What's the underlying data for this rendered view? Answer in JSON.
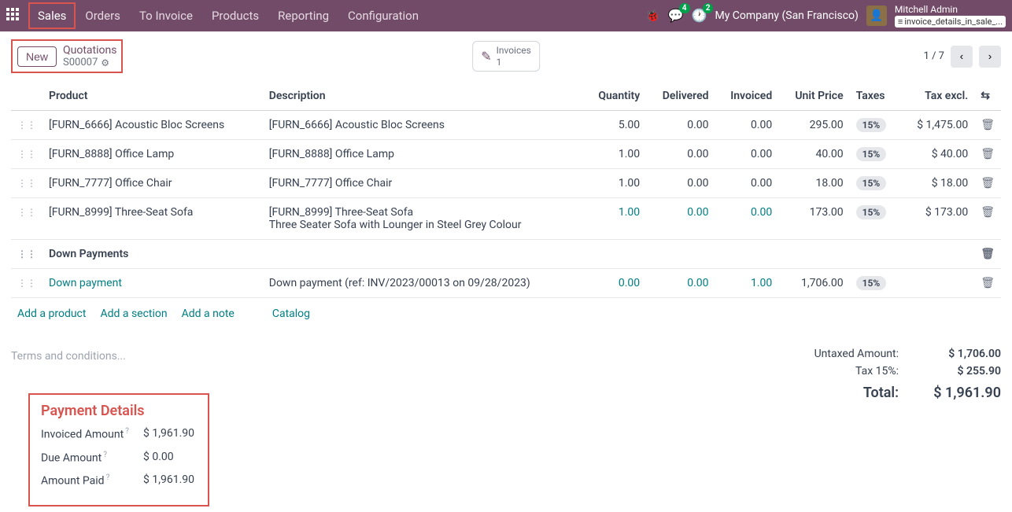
{
  "nav": {
    "items": [
      "Sales",
      "Orders",
      "To Invoice",
      "Products",
      "Reporting",
      "Configuration"
    ],
    "chat_count": "4",
    "activity_count": "2",
    "company": "My Company (San Francisco)",
    "user_name": "Mitchell Admin",
    "db_name": "invoice_details_in_sale_..."
  },
  "subheader": {
    "new_label": "New",
    "breadcrumb": "Quotations",
    "record": "S00007",
    "invoices_label": "Invoices",
    "invoices_count": "1",
    "page_text": "1 / 7"
  },
  "columns": {
    "product": "Product",
    "description": "Description",
    "quantity": "Quantity",
    "delivered": "Delivered",
    "invoiced": "Invoiced",
    "unit_price": "Unit Price",
    "taxes": "Taxes",
    "tax_excl": "Tax excl."
  },
  "lines": [
    {
      "product": "[FURN_6666] Acoustic Bloc Screens",
      "description": "[FURN_6666] Acoustic Bloc Screens",
      "qty": "5.00",
      "delivered": "0.00",
      "invoiced": "0.00",
      "unit_price": "295.00",
      "tax": "15%",
      "tax_excl": "$ 1,475.00",
      "highlight": false
    },
    {
      "product": "[FURN_8888] Office Lamp",
      "description": "[FURN_8888] Office Lamp",
      "qty": "1.00",
      "delivered": "0.00",
      "invoiced": "0.00",
      "unit_price": "40.00",
      "tax": "15%",
      "tax_excl": "$ 40.00",
      "highlight": false
    },
    {
      "product": "[FURN_7777] Office Chair",
      "description": "[FURN_7777] Office Chair",
      "qty": "1.00",
      "delivered": "0.00",
      "invoiced": "0.00",
      "unit_price": "18.00",
      "tax": "15%",
      "tax_excl": "$ 18.00",
      "highlight": false
    },
    {
      "product": "[FURN_8999] Three-Seat Sofa",
      "description": "[FURN_8999] Three-Seat Sofa\nThree Seater Sofa with Lounger in Steel Grey Colour",
      "qty": "1.00",
      "delivered": "0.00",
      "invoiced": "0.00",
      "unit_price": "173.00",
      "tax": "15%",
      "tax_excl": "$ 173.00",
      "highlight": true
    }
  ],
  "section": {
    "label": "Down Payments"
  },
  "downpayment": {
    "product": "Down payment",
    "description": "Down payment (ref: INV/2023/00013 on 09/28/2023)",
    "qty": "0.00",
    "delivered": "0.00",
    "invoiced": "1.00",
    "unit_price": "1,706.00",
    "tax": "15%"
  },
  "actions": {
    "add_product": "Add a product",
    "add_section": "Add a section",
    "add_note": "Add a note",
    "catalog": "Catalog"
  },
  "terms_placeholder": "Terms and conditions...",
  "totals": {
    "untaxed_label": "Untaxed Amount:",
    "untaxed_value": "$ 1,706.00",
    "tax_label": "Tax 15%:",
    "tax_value": "$ 255.90",
    "total_label": "Total:",
    "total_value": "$ 1,961.90"
  },
  "payment_details": {
    "title": "Payment Details",
    "invoiced_label": "Invoiced Amount",
    "invoiced_value": "$ 1,961.90",
    "due_label": "Due Amount",
    "due_value": "$ 0.00",
    "paid_label": "Amount Paid",
    "paid_value": "$ 1,961.90"
  }
}
